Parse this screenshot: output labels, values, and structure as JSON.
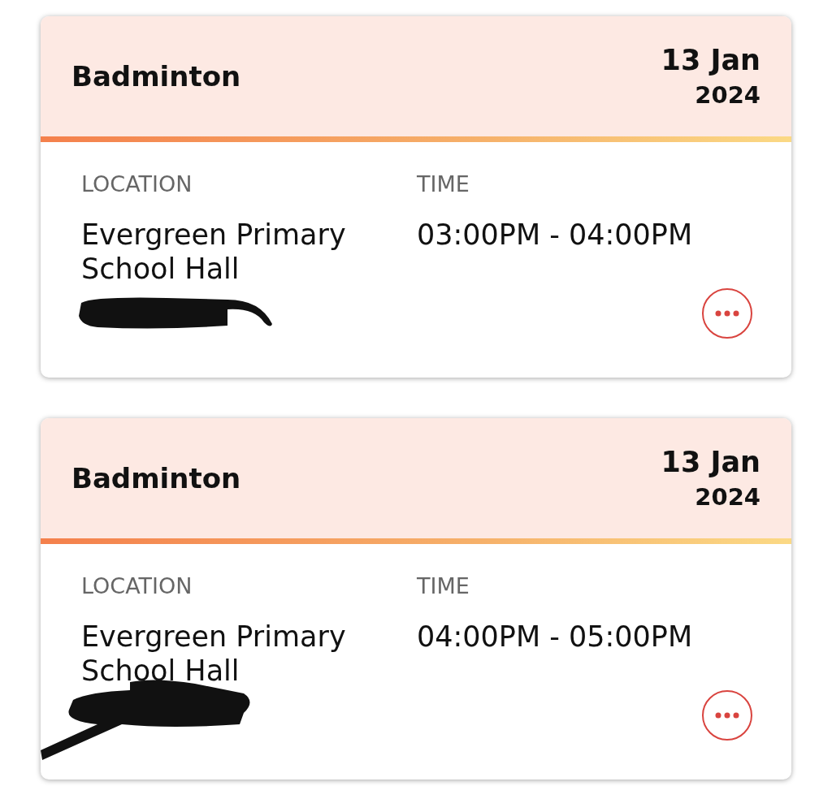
{
  "events": [
    {
      "title": "Badminton",
      "date": "13 Jan",
      "year": "2024",
      "location_label": "LOCATION",
      "location": "Evergreen Primary School Hall",
      "time_label": "TIME",
      "time": "03:00PM - 04:00PM"
    },
    {
      "title": "Badminton",
      "date": "13 Jan",
      "year": "2024",
      "location_label": "LOCATION",
      "location": "Evergreen Primary School Hall",
      "time_label": "TIME",
      "time": "04:00PM - 05:00PM"
    }
  ]
}
